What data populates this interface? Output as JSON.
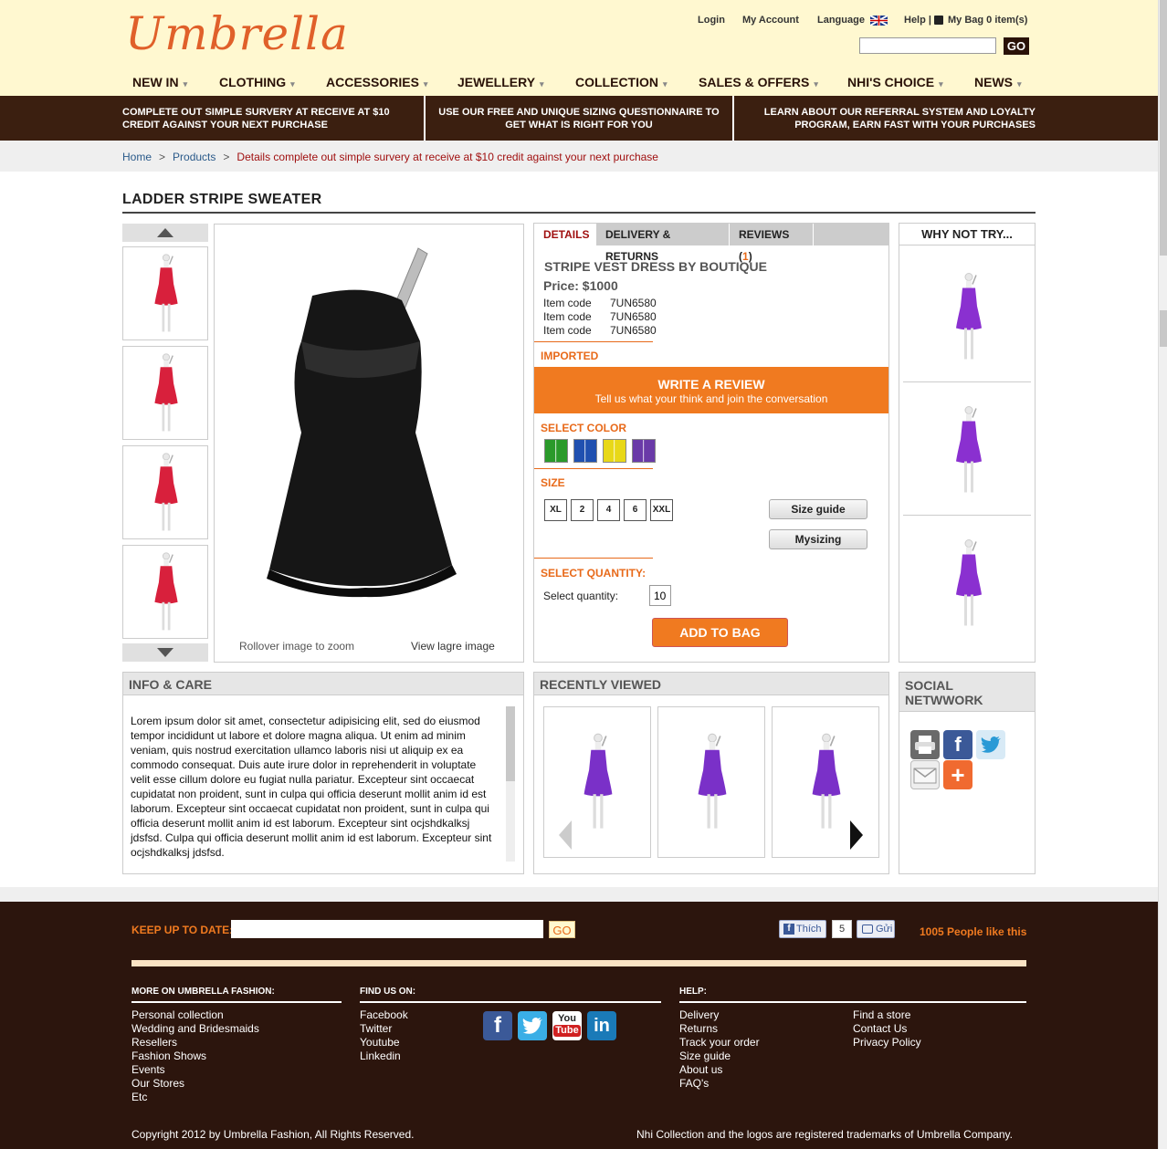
{
  "header": {
    "logo": "Umbrella",
    "links": {
      "login": "Login",
      "account": "My Account",
      "language": "Language",
      "help": "Help |",
      "bag": "My Bag 0 item(s)"
    },
    "search_value": "",
    "go": "GO"
  },
  "nav": [
    "NEW IN",
    "CLOTHING",
    "ACCESSORIES",
    "JEWELLERY",
    "COLLECTION",
    "SALES & OFFERS",
    "NHI'S CHOICE",
    "NEWS"
  ],
  "nav_caret": "▾",
  "promos": [
    "COMPLETE OUT SIMPLE SURVERY AT RECEIVE AT $10 CREDIT AGAINST YOUR NEXT PURCHASE",
    "USE OUR FREE AND UNIQUE SIZING QUESTIONNAIRE TO GET WHAT IS RIGHT FOR YOU",
    "LEARN ABOUT OUR REFERRAL SYSTEM AND LOYALTY PROGRAM, EARN FAST WITH YOUR PURCHASES"
  ],
  "breadcrumb": {
    "home": "Home",
    "products": "Products",
    "current": "Details complete out simple survery at receive at $10 credit against your next purchase",
    "sep": ">"
  },
  "page_title": "LADDER STRIPE SWEATER",
  "gallery": {
    "zoom_hint": "Rollover image to zoom",
    "view_large": "View lagre image"
  },
  "tabs": {
    "details": "DETAILS",
    "delivery": "DELIVERY & RETURNS",
    "reviews": "REVIEWS (",
    "reviews_count": "1",
    "reviews_close": ")"
  },
  "product": {
    "name": "STRIPE VEST DRESS BY BOUTIQUE",
    "price": "Price: $1000",
    "codes": [
      {
        "label": "Item code",
        "value": "7UN6580"
      },
      {
        "label": "Item code",
        "value": "7UN6580"
      },
      {
        "label": "Item code",
        "value": "7UN6580"
      }
    ],
    "imported": "IMPORTED"
  },
  "review": {
    "title": "WRITE A REVIEW",
    "subtitle": "Tell us what your think and join the conversation"
  },
  "color": {
    "label": "SELECT COLOR",
    "swatches": [
      "#2a9a2a",
      "#2050b0",
      "#e8d818",
      "#6a3aa8"
    ]
  },
  "size": {
    "label": "SIZE",
    "options": [
      "XL",
      "2",
      "4",
      "6",
      "XXL"
    ],
    "guide": "Size guide",
    "mysizing": "Mysizing"
  },
  "quantity": {
    "label": "SELECT QUANTITY:",
    "field_label": "Select quantity:",
    "value": "10"
  },
  "add_to_bag": "ADD TO BAG",
  "why_not": "WHY NOT TRY...",
  "info": {
    "title": "INFO & CARE",
    "text": "Lorem ipsum dolor sit amet, consectetur adipisicing elit, sed do eiusmod tempor incididunt ut labore et dolore magna aliqua. Ut enim ad minim veniam, quis nostrud exercitation ullamco laboris nisi ut aliquip ex ea commodo consequat. Duis aute irure dolor in reprehenderit in voluptate velit esse cillum dolore eu fugiat nulla pariatur. Excepteur sint occaecat cupidatat non proident, sunt in culpa qui officia deserunt mollit anim id est laborum. Excepteur sint occaecat cupidatat non proident, sunt in culpa qui officia deserunt mollit anim id est laborum. Excepteur sint ocjshdkalksj jdsfsd. Culpa qui officia deserunt mollit anim id est laborum. Excepteur sint ocjshdkalksj jdsfsd."
  },
  "recent": {
    "title": "RECENTLY VIEWED"
  },
  "social": {
    "title": "SOCIAL NETWWORK"
  },
  "footer": {
    "keep_label": "KEEP UP TO DATE:",
    "go": "GO",
    "like": "Thích",
    "like_count": "5",
    "send": "Gửi",
    "people": "1005 People like this",
    "more_title": "MORE ON UMBRELLA FASHION:",
    "more_links": [
      "Personal collection",
      "Wedding and Bridesmaids",
      "Resellers",
      "Fashion Shows",
      "Events",
      "Our Stores",
      "Etc"
    ],
    "find_title": "FIND US ON:",
    "find_links": [
      "Facebook",
      "Twitter",
      "Youtube",
      "Linkedin"
    ],
    "help_title": "HELP:",
    "help_links_1": [
      "Delivery",
      "Returns",
      "Track your order",
      "Size guide",
      "About us",
      "FAQ's"
    ],
    "help_links_2": [
      "Find a store",
      "Contact Us",
      "Privacy Policy"
    ],
    "copyright": "Copyright 2012 by Umbrella Fashion, All Rights Reserved.",
    "trademark": "Nhi Collection and the logos are registered trademarks of Umbrella Company."
  }
}
